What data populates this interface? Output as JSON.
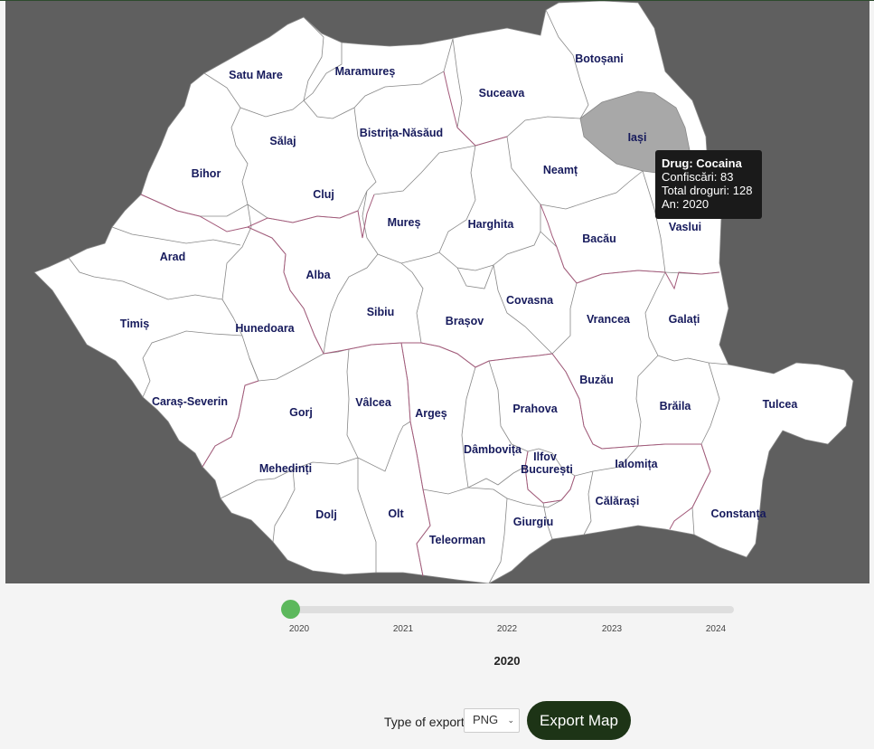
{
  "map": {
    "counties": [
      {
        "name": "Satu Mare"
      },
      {
        "name": "Maramureș"
      },
      {
        "name": "Botoșani"
      },
      {
        "name": "Suceava"
      },
      {
        "name": "Iași"
      },
      {
        "name": "Sălaj"
      },
      {
        "name": "Bistrița-Năsăud"
      },
      {
        "name": "Bihor"
      },
      {
        "name": "Neamț"
      },
      {
        "name": "Cluj"
      },
      {
        "name": "Mureș"
      },
      {
        "name": "Harghita"
      },
      {
        "name": "Bacău"
      },
      {
        "name": "Vaslui"
      },
      {
        "name": "Arad"
      },
      {
        "name": "Alba"
      },
      {
        "name": "Covasna"
      },
      {
        "name": "Timiș"
      },
      {
        "name": "Hunedoara"
      },
      {
        "name": "Sibiu"
      },
      {
        "name": "Brașov"
      },
      {
        "name": "Vrancea"
      },
      {
        "name": "Galați"
      },
      {
        "name": "Buzău"
      },
      {
        "name": "Caraș-Severin"
      },
      {
        "name": "Vâlcea"
      },
      {
        "name": "Gorj"
      },
      {
        "name": "Argeș"
      },
      {
        "name": "Prahova"
      },
      {
        "name": "Brăila"
      },
      {
        "name": "Tulcea"
      },
      {
        "name": "Dâmbovița"
      },
      {
        "name": "Ilfov"
      },
      {
        "name": "București"
      },
      {
        "name": "Ialomița"
      },
      {
        "name": "Mehedinți"
      },
      {
        "name": "Călărași"
      },
      {
        "name": "Dolj"
      },
      {
        "name": "Olt"
      },
      {
        "name": "Constanța"
      },
      {
        "name": "Giurgiu"
      },
      {
        "name": "Teleorman"
      }
    ],
    "highlighted_county": "Iași",
    "colors": {
      "background": "#5f5f5f",
      "county_fill": "#ffffff",
      "highlight_fill": "#a8a8a8",
      "label": "#161a5c",
      "region_border": "#a35a7a"
    }
  },
  "tooltip": {
    "drug": "Drug: Cocaina",
    "seizures": "Confiscări: 83",
    "total": "Total droguri: 128",
    "year": "An: 2020"
  },
  "slider": {
    "ticks": [
      "2020",
      "2021",
      "2022",
      "2023",
      "2024"
    ],
    "current_value": "2020",
    "position_fraction": 0
  },
  "export": {
    "label": "Type of export",
    "selected": "PNG",
    "button": "Export Map"
  }
}
